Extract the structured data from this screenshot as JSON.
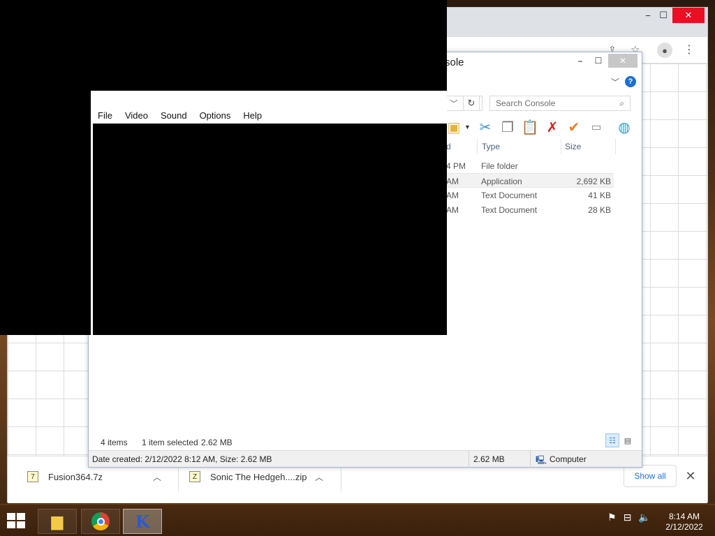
{
  "chrome": {
    "minimize": "⎯",
    "maximize": "☐",
    "close": "✕"
  },
  "downloads": {
    "items": [
      {
        "name": "Fusion364.7z",
        "icon": "archive-7z-icon"
      },
      {
        "name": "Sonic The Hedgeh....zip",
        "icon": "archive-zip-icon"
      }
    ],
    "show_all": "Show all",
    "close": "✕"
  },
  "explorer": {
    "title": "sole",
    "search_placeholder": "Search Console",
    "columns": {
      "type": "Type",
      "size": "Size",
      "date_partial": "d"
    },
    "files": [
      {
        "date": "4 PM",
        "type": "File folder",
        "size": ""
      },
      {
        "date": "AM",
        "type": "Application",
        "size": "2,692 KB"
      },
      {
        "date": "AM",
        "type": "Text Document",
        "size": "41 KB"
      },
      {
        "date": "AM",
        "type": "Text Document",
        "size": "28 KB"
      }
    ],
    "status": {
      "items": "4 items",
      "selected": "1 item selected",
      "selected_size": "2.62 MB"
    },
    "details": {
      "created": "Date created: 2/12/2022 8:12 AM, Size: 2.62 MB",
      "size": "2.62 MB",
      "location": "Computer"
    },
    "help": "?"
  },
  "emulator": {
    "menu": [
      "File",
      "Video",
      "Sound",
      "Options",
      "Help"
    ]
  },
  "taskbar": {
    "time": "8:14 AM",
    "date": "2/12/2022"
  }
}
